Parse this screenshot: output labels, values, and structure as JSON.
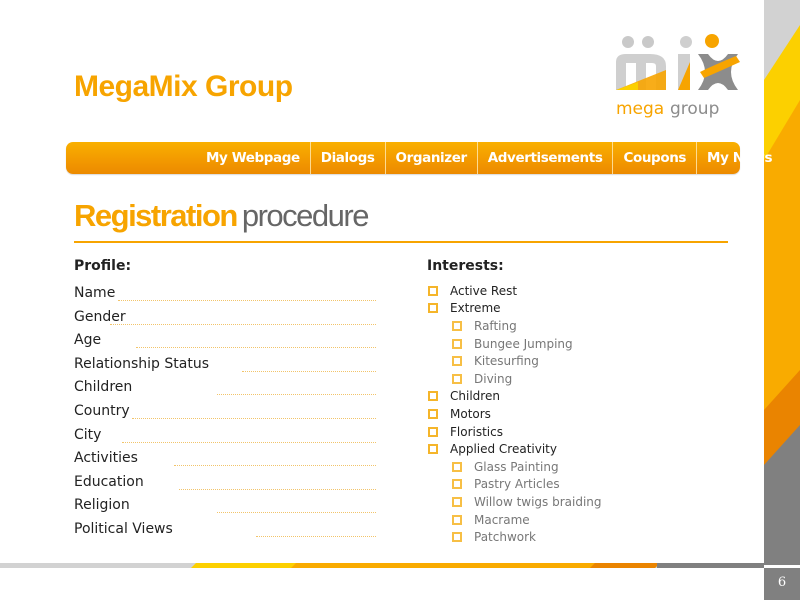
{
  "header": {
    "brand_title": "MegaMix Group",
    "logo": {
      "mark": "mix",
      "tagline_accent": "mega",
      "tagline_rest": "group",
      "icon": "mix-people-logo-icon"
    }
  },
  "nav": {
    "items": [
      {
        "label": "My Webpage"
      },
      {
        "label": "Dialogs"
      },
      {
        "label": "Organizer"
      },
      {
        "label": "Advertisements"
      },
      {
        "label": "Coupons"
      },
      {
        "label": "My News"
      }
    ]
  },
  "section": {
    "title_strong": "Registration",
    "title_light": "procedure"
  },
  "profile": {
    "heading": "Profile:",
    "fields": [
      {
        "label": "Name",
        "value": ""
      },
      {
        "label": "Gender",
        "value": ""
      },
      {
        "label": "Age",
        "value": ""
      },
      {
        "label": "Relationship  Status",
        "value": ""
      },
      {
        "label": "Children",
        "value": ""
      },
      {
        "label": "Country",
        "value": ""
      },
      {
        "label": "City",
        "value": ""
      },
      {
        "label": "Activities",
        "value": ""
      },
      {
        "label": "Education",
        "value": ""
      },
      {
        "label": "Religion",
        "value": ""
      },
      {
        "label": "Political Views",
        "value": ""
      }
    ]
  },
  "interests": {
    "heading": "Interests:",
    "items": [
      {
        "label": "Active Rest",
        "level": 0,
        "checked": false
      },
      {
        "label": "Extreme",
        "level": 0,
        "checked": false
      },
      {
        "label": "Rafting",
        "level": 1,
        "checked": false
      },
      {
        "label": "Bungee Jumping",
        "level": 1,
        "checked": false
      },
      {
        "label": "Kitesurfing",
        "level": 1,
        "checked": false
      },
      {
        "label": "Diving",
        "level": 1,
        "checked": false
      },
      {
        "label": "Children",
        "level": 0,
        "checked": false
      },
      {
        "label": "Motors",
        "level": 0,
        "checked": false
      },
      {
        "label": "Floristics",
        "level": 0,
        "checked": false
      },
      {
        "label": "Applied Creativity",
        "level": 0,
        "checked": false
      },
      {
        "label": "Glass Painting",
        "level": 1,
        "checked": false
      },
      {
        "label": "Pastry Articles",
        "level": 1,
        "checked": false
      },
      {
        "label": "Willow twigs braiding",
        "level": 1,
        "checked": false
      },
      {
        "label": "Macrame",
        "level": 1,
        "checked": false
      },
      {
        "label": "Patchwork",
        "level": 1,
        "checked": false
      }
    ]
  },
  "footer": {
    "page_number": "6"
  },
  "colors": {
    "brand_orange": "#f7a400",
    "nav_orange": "#f39a00",
    "accent_yellow": "#fcd000",
    "dark_orange": "#ea8400",
    "gray": "#808080",
    "light_gray": "#d0d0d0"
  }
}
